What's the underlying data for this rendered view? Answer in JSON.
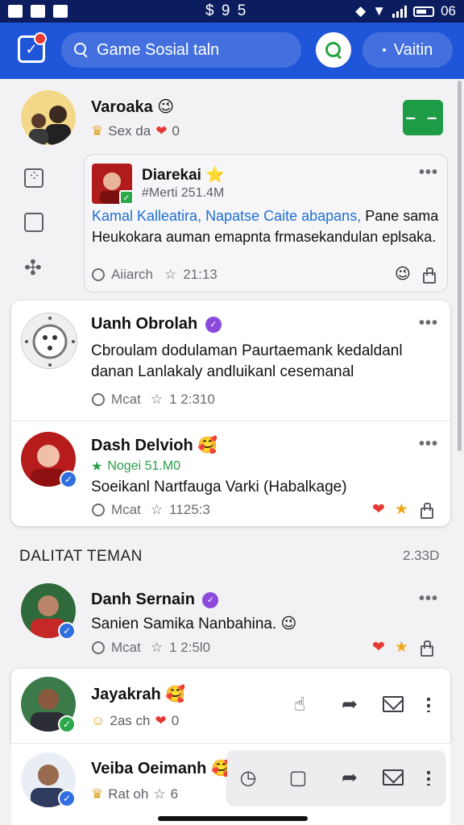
{
  "status_bar": {
    "center": "$ 9 5",
    "right_text": "06"
  },
  "header": {
    "search_placeholder": "Game Sosial taln",
    "action_label": "Vaitin"
  },
  "profile": {
    "name": "Varoaka",
    "name_emoji": "😉",
    "stats": "Sex da",
    "hearts": "0",
    "follow_label": "– –"
  },
  "quoted_post": {
    "author": "Diarekai",
    "author_emoji": "⭐",
    "tag": "#Merti 251.4M",
    "link_text": "Kamal Kalleatira, Napatse Caite abapans,",
    "body_rest": " Pane sama Heukokara auman emapnta frmasekandulan eplsaka.",
    "meta_label": "Aiiarch",
    "time": "21:13",
    "react_emoji": "😉"
  },
  "posts": [
    {
      "author": "Uanh Obrolah",
      "body": "Cbroulam dodulaman Paurtaemank kedaldanl danan Lanlakaly andluikanl cesemanal",
      "meta_label": "Mcat",
      "time": "1 2:310"
    },
    {
      "author": "Dash Delvioh",
      "author_emoji": "🥰",
      "tag": "Nogei 51.M0",
      "body": "Soeikanl Nartfauga Varki (Habalkage)",
      "meta_label": "Mcat",
      "time": "1125:3"
    }
  ],
  "section": {
    "title": "DALITAT TEMAN",
    "count": "2.33D"
  },
  "friends": [
    {
      "name": "Danh Sernain",
      "body": "Sanien Samika Nanbahina.",
      "body_emoji": "😉",
      "meta_label": "Mcat",
      "time": "1 2:5l0"
    },
    {
      "name": "Jayakrah",
      "name_emoji": "🥰",
      "status": "2as ch",
      "hearts": "0"
    },
    {
      "name": "Veiba Oeimanh",
      "name_emoji": "🥰",
      "status": "Rat oh",
      "stars": "6"
    }
  ],
  "colors": {
    "header_blue": "#1f55d8",
    "status_navy": "#0b1d5e",
    "accent_green": "#1e9b45",
    "link_blue": "#1f6fd0",
    "verified_purple": "#8a4bdc"
  }
}
